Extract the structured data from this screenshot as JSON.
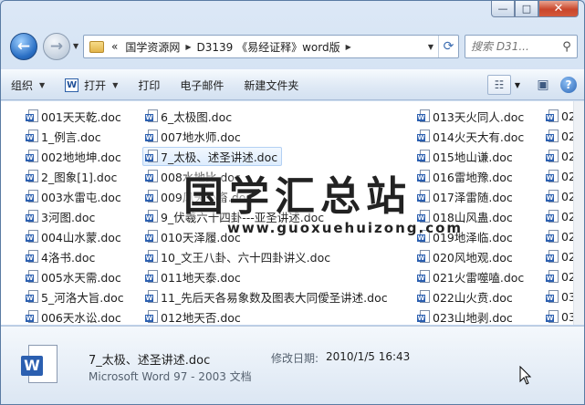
{
  "window": {
    "caption_buttons": {
      "minimize": "—",
      "maximize": "□",
      "close": "✕"
    }
  },
  "address": {
    "overflow": "«",
    "crumbs": [
      "国学资源网",
      "D3139 《易经证释》word版"
    ],
    "search_placeholder": "搜索 D31..."
  },
  "toolbar": {
    "organize": "组织",
    "open": "打开",
    "print": "打印",
    "email": "电子邮件",
    "new_folder": "新建文件夹"
  },
  "files": {
    "col1": [
      "001天天乾.doc",
      "1_例言.doc",
      "002地地坤.doc",
      "2_图象[1].doc",
      "003水雷屯.doc",
      "3河图.doc",
      "004山水蒙.doc",
      "4洛书.doc",
      "005水天需.doc",
      "5_河洛大旨.doc",
      "006天水讼.doc"
    ],
    "col2": [
      "6_太极图.doc",
      "007地水师.doc",
      "7_太极、述圣讲述.doc",
      "008水地比.doc",
      "009风天小畜.doc",
      "9_伏羲六十四卦---亚圣讲述.doc",
      "010天泽履.doc",
      "10_文王八卦、六十四卦讲义.doc",
      "011地天泰.doc",
      "11_先后天各易象数及图表大同僾圣讲述.doc",
      "012地天否.doc"
    ],
    "col3": [
      "013天火同人.doc",
      "014火天大有.doc",
      "015地山谦.doc",
      "016雷地豫.doc",
      "017泽雷随.doc",
      "018山风蛊.doc",
      "019地泽临.doc",
      "020风地观.doc",
      "021火雷噬嗑.doc",
      "022山火贲.doc",
      "023山地剥.doc"
    ],
    "col4": [
      "02",
      "02",
      "02",
      "02",
      "02",
      "02",
      "02",
      "02",
      "02",
      "03",
      "03"
    ]
  },
  "watermark": {
    "title": "国学汇总站",
    "url": "www.guoxuehuizong.com"
  },
  "details": {
    "name": "7_太极、述圣讲述.doc",
    "modified_label": "修改日期:",
    "modified_value": "2010/1/5 16:43",
    "type": "Microsoft Word 97 - 2003 文档"
  },
  "colors": {
    "accent": "#2b5fb0",
    "selection": "#ddecfd",
    "close_button": "#c9462b"
  },
  "icons": {
    "back": "back-arrow-icon",
    "forward": "forward-arrow-icon",
    "folder": "folder-icon",
    "refresh": "refresh-icon",
    "search": "search-icon",
    "word": "word-document-icon",
    "help": "help-icon"
  }
}
